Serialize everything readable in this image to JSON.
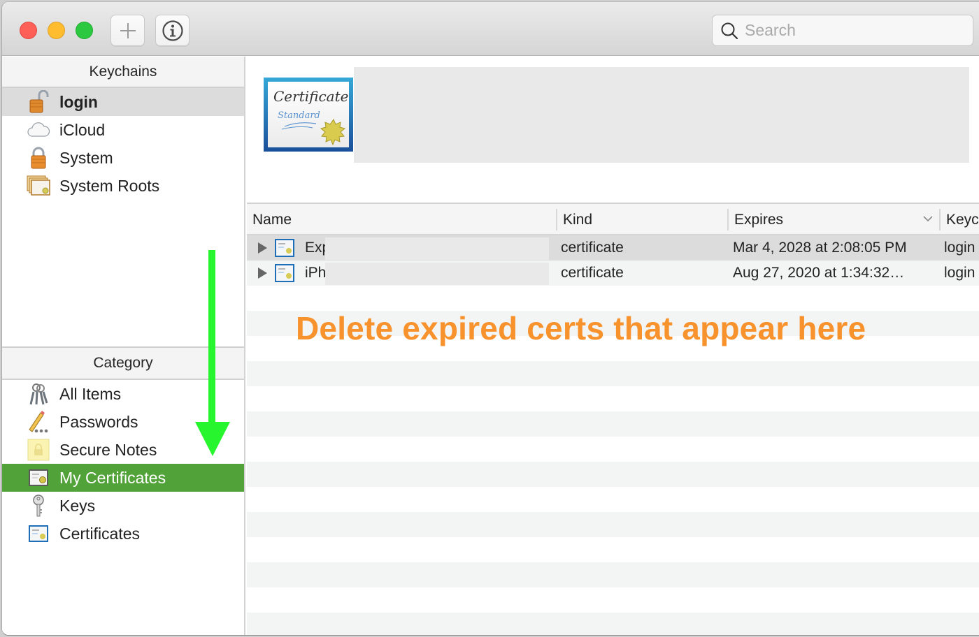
{
  "window": {
    "toolbar": {
      "add_button_icon": "plus-icon",
      "info_button_icon": "info-icon",
      "search": {
        "placeholder": "Search",
        "value": "",
        "icon": "search-icon"
      }
    }
  },
  "sidebar": {
    "keychains_header": "Keychains",
    "keychains": [
      {
        "label": "login",
        "icon": "unlocked-padlock-icon",
        "selected": true
      },
      {
        "label": "iCloud",
        "icon": "cloud-icon",
        "selected": false
      },
      {
        "label": "System",
        "icon": "locked-padlock-icon",
        "selected": false
      },
      {
        "label": "System Roots",
        "icon": "certificate-stack-icon",
        "selected": false
      }
    ],
    "category_header": "Category",
    "categories": [
      {
        "label": "All Items",
        "icon": "keys-icon",
        "selected": false
      },
      {
        "label": "Passwords",
        "icon": "pencil-icon",
        "selected": false
      },
      {
        "label": "Secure Notes",
        "icon": "note-icon",
        "selected": false
      },
      {
        "label": "My Certificates",
        "icon": "my-certificate-icon",
        "selected": true
      },
      {
        "label": "Keys",
        "icon": "key-icon",
        "selected": false
      },
      {
        "label": "Certificates",
        "icon": "certificate-icon",
        "selected": false
      }
    ]
  },
  "preview": {
    "icon": "certificate-standard-icon",
    "cert_title": "Certificate",
    "cert_subtitle": "Standard"
  },
  "table": {
    "columns": [
      "Name",
      "Kind",
      "Expires",
      "Keyc"
    ],
    "sort_column": "Expires",
    "sort_direction": "descending",
    "rows": [
      {
        "name": "Exp",
        "kind": "certificate",
        "expires": "Mar 4, 2028 at 2:08:05 PM",
        "keychain": "login",
        "selected": true
      },
      {
        "name": "iPh",
        "kind": "certificate",
        "expires": "Aug 27, 2020 at 1:34:32…",
        "keychain": "login",
        "selected": false
      }
    ]
  },
  "annotations": {
    "text": "Delete expired certs that appear here",
    "text_color": "#f7922c",
    "arrow_color": "#27f52d",
    "arrow_target": "My Certificates"
  },
  "colors": {
    "selection_green": "#52a23a",
    "selection_gray": "#dcdcdc"
  }
}
